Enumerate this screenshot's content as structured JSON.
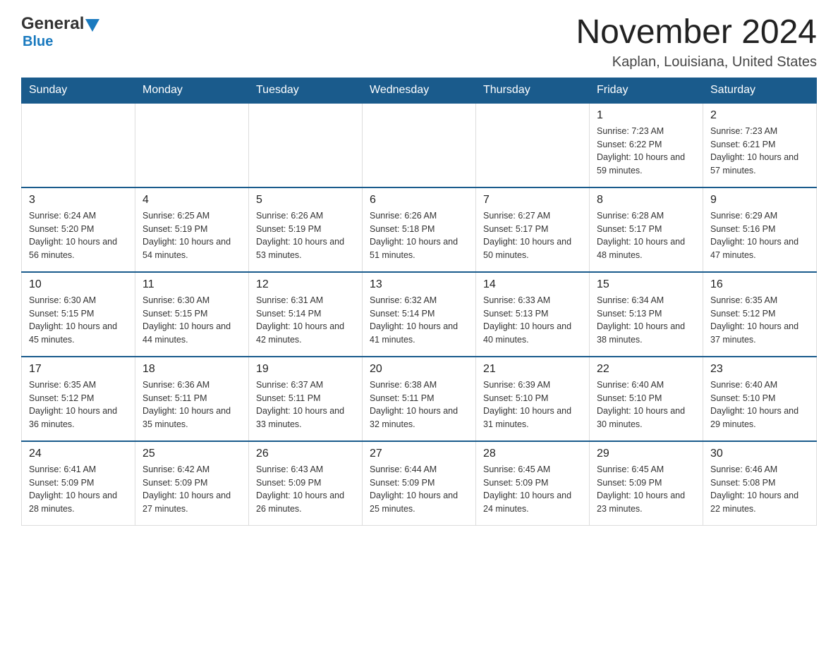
{
  "header": {
    "logo_text_general": "General",
    "logo_text_blue": "Blue",
    "main_title": "November 2024",
    "subtitle": "Kaplan, Louisiana, United States"
  },
  "calendar": {
    "days_of_week": [
      "Sunday",
      "Monday",
      "Tuesday",
      "Wednesday",
      "Thursday",
      "Friday",
      "Saturday"
    ],
    "weeks": [
      [
        {
          "day": "",
          "info": ""
        },
        {
          "day": "",
          "info": ""
        },
        {
          "day": "",
          "info": ""
        },
        {
          "day": "",
          "info": ""
        },
        {
          "day": "",
          "info": ""
        },
        {
          "day": "1",
          "info": "Sunrise: 7:23 AM\nSunset: 6:22 PM\nDaylight: 10 hours and 59 minutes."
        },
        {
          "day": "2",
          "info": "Sunrise: 7:23 AM\nSunset: 6:21 PM\nDaylight: 10 hours and 57 minutes."
        }
      ],
      [
        {
          "day": "3",
          "info": "Sunrise: 6:24 AM\nSunset: 5:20 PM\nDaylight: 10 hours and 56 minutes."
        },
        {
          "day": "4",
          "info": "Sunrise: 6:25 AM\nSunset: 5:19 PM\nDaylight: 10 hours and 54 minutes."
        },
        {
          "day": "5",
          "info": "Sunrise: 6:26 AM\nSunset: 5:19 PM\nDaylight: 10 hours and 53 minutes."
        },
        {
          "day": "6",
          "info": "Sunrise: 6:26 AM\nSunset: 5:18 PM\nDaylight: 10 hours and 51 minutes."
        },
        {
          "day": "7",
          "info": "Sunrise: 6:27 AM\nSunset: 5:17 PM\nDaylight: 10 hours and 50 minutes."
        },
        {
          "day": "8",
          "info": "Sunrise: 6:28 AM\nSunset: 5:17 PM\nDaylight: 10 hours and 48 minutes."
        },
        {
          "day": "9",
          "info": "Sunrise: 6:29 AM\nSunset: 5:16 PM\nDaylight: 10 hours and 47 minutes."
        }
      ],
      [
        {
          "day": "10",
          "info": "Sunrise: 6:30 AM\nSunset: 5:15 PM\nDaylight: 10 hours and 45 minutes."
        },
        {
          "day": "11",
          "info": "Sunrise: 6:30 AM\nSunset: 5:15 PM\nDaylight: 10 hours and 44 minutes."
        },
        {
          "day": "12",
          "info": "Sunrise: 6:31 AM\nSunset: 5:14 PM\nDaylight: 10 hours and 42 minutes."
        },
        {
          "day": "13",
          "info": "Sunrise: 6:32 AM\nSunset: 5:14 PM\nDaylight: 10 hours and 41 minutes."
        },
        {
          "day": "14",
          "info": "Sunrise: 6:33 AM\nSunset: 5:13 PM\nDaylight: 10 hours and 40 minutes."
        },
        {
          "day": "15",
          "info": "Sunrise: 6:34 AM\nSunset: 5:13 PM\nDaylight: 10 hours and 38 minutes."
        },
        {
          "day": "16",
          "info": "Sunrise: 6:35 AM\nSunset: 5:12 PM\nDaylight: 10 hours and 37 minutes."
        }
      ],
      [
        {
          "day": "17",
          "info": "Sunrise: 6:35 AM\nSunset: 5:12 PM\nDaylight: 10 hours and 36 minutes."
        },
        {
          "day": "18",
          "info": "Sunrise: 6:36 AM\nSunset: 5:11 PM\nDaylight: 10 hours and 35 minutes."
        },
        {
          "day": "19",
          "info": "Sunrise: 6:37 AM\nSunset: 5:11 PM\nDaylight: 10 hours and 33 minutes."
        },
        {
          "day": "20",
          "info": "Sunrise: 6:38 AM\nSunset: 5:11 PM\nDaylight: 10 hours and 32 minutes."
        },
        {
          "day": "21",
          "info": "Sunrise: 6:39 AM\nSunset: 5:10 PM\nDaylight: 10 hours and 31 minutes."
        },
        {
          "day": "22",
          "info": "Sunrise: 6:40 AM\nSunset: 5:10 PM\nDaylight: 10 hours and 30 minutes."
        },
        {
          "day": "23",
          "info": "Sunrise: 6:40 AM\nSunset: 5:10 PM\nDaylight: 10 hours and 29 minutes."
        }
      ],
      [
        {
          "day": "24",
          "info": "Sunrise: 6:41 AM\nSunset: 5:09 PM\nDaylight: 10 hours and 28 minutes."
        },
        {
          "day": "25",
          "info": "Sunrise: 6:42 AM\nSunset: 5:09 PM\nDaylight: 10 hours and 27 minutes."
        },
        {
          "day": "26",
          "info": "Sunrise: 6:43 AM\nSunset: 5:09 PM\nDaylight: 10 hours and 26 minutes."
        },
        {
          "day": "27",
          "info": "Sunrise: 6:44 AM\nSunset: 5:09 PM\nDaylight: 10 hours and 25 minutes."
        },
        {
          "day": "28",
          "info": "Sunrise: 6:45 AM\nSunset: 5:09 PM\nDaylight: 10 hours and 24 minutes."
        },
        {
          "day": "29",
          "info": "Sunrise: 6:45 AM\nSunset: 5:09 PM\nDaylight: 10 hours and 23 minutes."
        },
        {
          "day": "30",
          "info": "Sunrise: 6:46 AM\nSunset: 5:08 PM\nDaylight: 10 hours and 22 minutes."
        }
      ]
    ]
  }
}
